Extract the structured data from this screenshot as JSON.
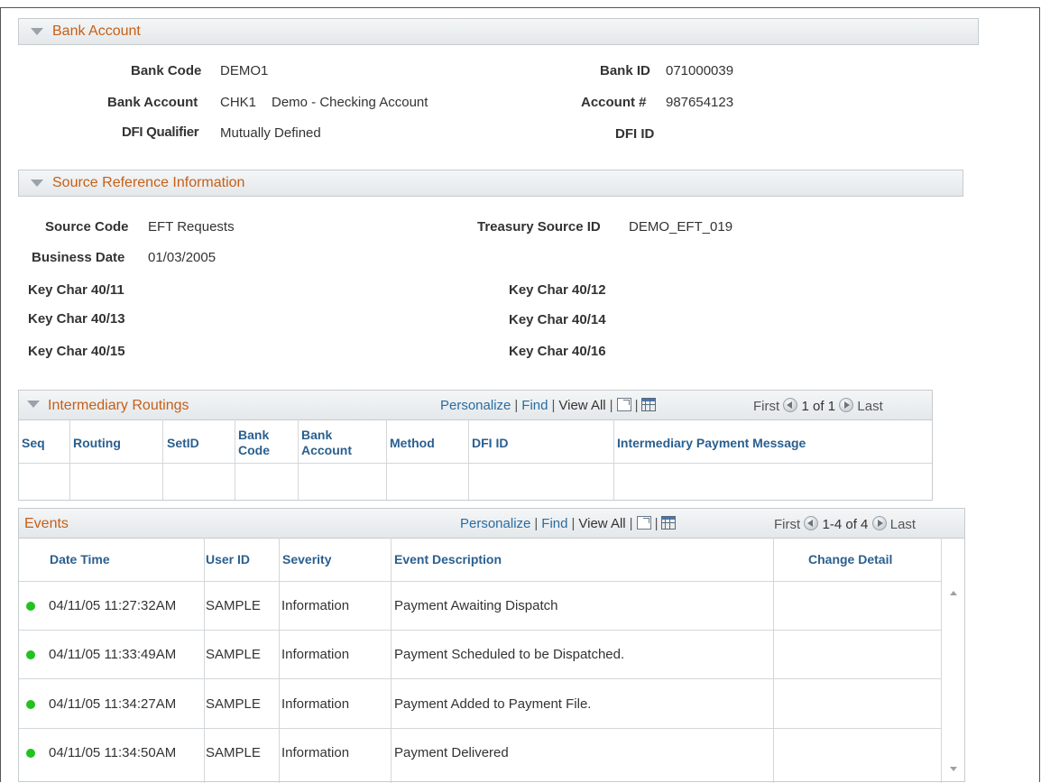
{
  "bank_account": {
    "title": "Bank Account",
    "bank_code_label": "Bank Code",
    "bank_code_value": "DEMO1",
    "bank_id_label": "Bank ID",
    "bank_id_value": "071000039",
    "bank_account_label": "Bank Account",
    "bank_account_value": "CHK1",
    "bank_account_desc": "Demo - Checking Account",
    "account_num_label": "Account #",
    "account_num_value": "987654123",
    "dfi_qualifier_label": "DFI Qualifier",
    "dfi_qualifier_value": "Mutually Defined",
    "dfi_id_label": "DFI ID"
  },
  "source_ref": {
    "title": "Source Reference Information",
    "source_code_label": "Source Code",
    "source_code_value": "EFT Requests",
    "treasury_source_id_label": "Treasury Source ID",
    "treasury_source_id_value": "DEMO_EFT_019",
    "business_date_label": "Business Date",
    "business_date_value": "01/03/2005",
    "key_char_11": "Key Char 40/11",
    "key_char_12": "Key Char 40/12",
    "key_char_13": "Key Char 40/13",
    "key_char_14": "Key Char 40/14",
    "key_char_15": "Key Char 40/15",
    "key_char_16": "Key Char 40/16"
  },
  "routings": {
    "title": "Intermediary Routings",
    "personalize": "Personalize",
    "find": "Find",
    "view_all": "View All",
    "first": "First",
    "range": "1 of 1",
    "last": "Last",
    "columns": [
      "Seq",
      "Routing",
      "SetID",
      "Bank",
      "Code",
      "Bank",
      "Account",
      "Method",
      "DFI ID",
      "Intermediary Payment Message"
    ]
  },
  "events": {
    "title": "Events",
    "personalize": "Personalize",
    "find": "Find",
    "view_all": "View All",
    "first": "First",
    "range": "1-4 of 4",
    "last": "Last",
    "columns": [
      "Date Time",
      "User ID",
      "Severity",
      "Event Description",
      "Change Detail"
    ],
    "status_color": "#22c21f",
    "rows": [
      {
        "datetime": "04/11/05 11:27:32AM",
        "user": "SAMPLE",
        "severity": "Information",
        "description": "Payment Awaiting Dispatch"
      },
      {
        "datetime": "04/11/05 11:33:49AM",
        "user": "SAMPLE",
        "severity": "Information",
        "description": "Payment Scheduled to be Dispatched."
      },
      {
        "datetime": "04/11/05 11:34:27AM",
        "user": "SAMPLE",
        "severity": "Information",
        "description": "Payment Added to Payment File."
      },
      {
        "datetime": "04/11/05 11:34:50AM",
        "user": "SAMPLE",
        "severity": "Information",
        "description": "Payment Delivered"
      }
    ]
  }
}
